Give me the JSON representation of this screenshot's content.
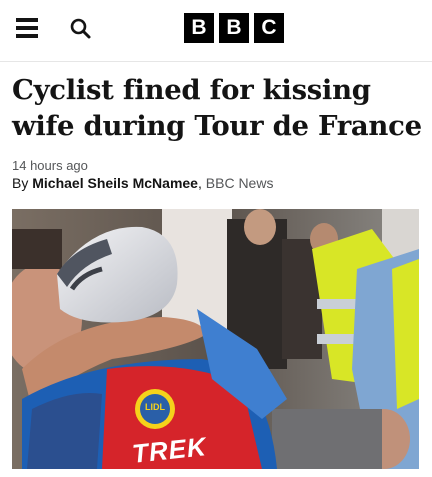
{
  "header": {
    "menu_icon": "hamburger-menu-icon",
    "search_icon": "search-icon",
    "logo_letters": [
      "B",
      "B",
      "C"
    ]
  },
  "article": {
    "headline": "Cyclist fined for kissing wife during Tour de France",
    "timestamp": "14 hours ago",
    "byline_prefix": "By ",
    "author": "Michael Sheils McNamee",
    "byline_sep": ", ",
    "outlet": "BBC News"
  },
  "photo": {
    "jersey_text": "TREK",
    "badge_text": "LIDL"
  },
  "colors": {
    "brand_black": "#000000",
    "jersey_blue": "#1d5fb4",
    "jersey_red": "#d5242a",
    "lidl_yellow": "#f5d21b",
    "hi_vis": "#d8e626"
  }
}
